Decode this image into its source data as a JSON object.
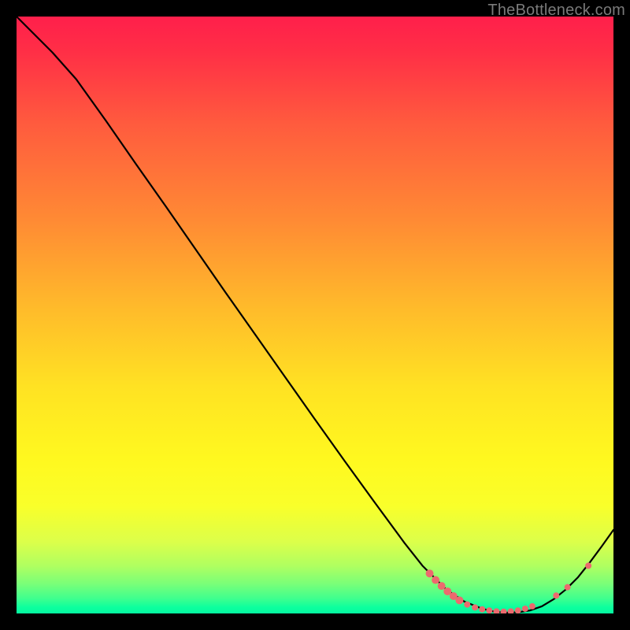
{
  "watermark": "TheBottleneck.com",
  "colors": {
    "curve": "#000000",
    "marker_fill": "#ec6a6e",
    "marker_stroke": "#ec6a6e"
  },
  "chart_data": {
    "type": "line",
    "title": "",
    "xlabel": "",
    "ylabel": "",
    "xlim": [
      0,
      100
    ],
    "ylim": [
      0,
      100
    ],
    "grid": false,
    "legend": false,
    "comment": "x/y in percent of plot area; y measured from bottom (0) to top (100). Curve descends from top-left, bottoms out near x≈82 then rises toward top-right. Markers cluster on the basin and right ascent.",
    "series": [
      {
        "name": "curve",
        "x": [
          0,
          3,
          6,
          10,
          15,
          20,
          25,
          30,
          35,
          40,
          45,
          50,
          55,
          60,
          65,
          68,
          72,
          75,
          78,
          80,
          82,
          84,
          86,
          88,
          90,
          92,
          94,
          96,
          98,
          100
        ],
        "y": [
          100,
          97,
          94,
          89.5,
          82.5,
          75.3,
          68.2,
          61,
          53.8,
          46.7,
          39.6,
          32.5,
          25.5,
          18.6,
          11.8,
          8,
          4,
          2,
          0.8,
          0.3,
          0.15,
          0.2,
          0.5,
          1.2,
          2.4,
          4,
          6,
          8.5,
          11.2,
          14
        ]
      }
    ],
    "markers": [
      {
        "x": 69.2,
        "y": 6.7,
        "r": 5
      },
      {
        "x": 70.2,
        "y": 5.6,
        "r": 5
      },
      {
        "x": 71.2,
        "y": 4.6,
        "r": 5
      },
      {
        "x": 72.2,
        "y": 3.7,
        "r": 5
      },
      {
        "x": 73.2,
        "y": 2.9,
        "r": 5
      },
      {
        "x": 74.2,
        "y": 2.2,
        "r": 5
      },
      {
        "x": 75.5,
        "y": 1.5,
        "r": 4
      },
      {
        "x": 76.8,
        "y": 1.0,
        "r": 4
      },
      {
        "x": 78.0,
        "y": 0.7,
        "r": 4
      },
      {
        "x": 79.2,
        "y": 0.5,
        "r": 4
      },
      {
        "x": 80.4,
        "y": 0.35,
        "r": 4
      },
      {
        "x": 81.6,
        "y": 0.3,
        "r": 4
      },
      {
        "x": 82.8,
        "y": 0.35,
        "r": 4
      },
      {
        "x": 84.0,
        "y": 0.5,
        "r": 4
      },
      {
        "x": 85.2,
        "y": 0.8,
        "r": 4
      },
      {
        "x": 86.4,
        "y": 1.2,
        "r": 4
      },
      {
        "x": 90.4,
        "y": 3.0,
        "r": 4
      },
      {
        "x": 92.3,
        "y": 4.4,
        "r": 4
      },
      {
        "x": 95.8,
        "y": 8.0,
        "r": 4
      }
    ]
  }
}
